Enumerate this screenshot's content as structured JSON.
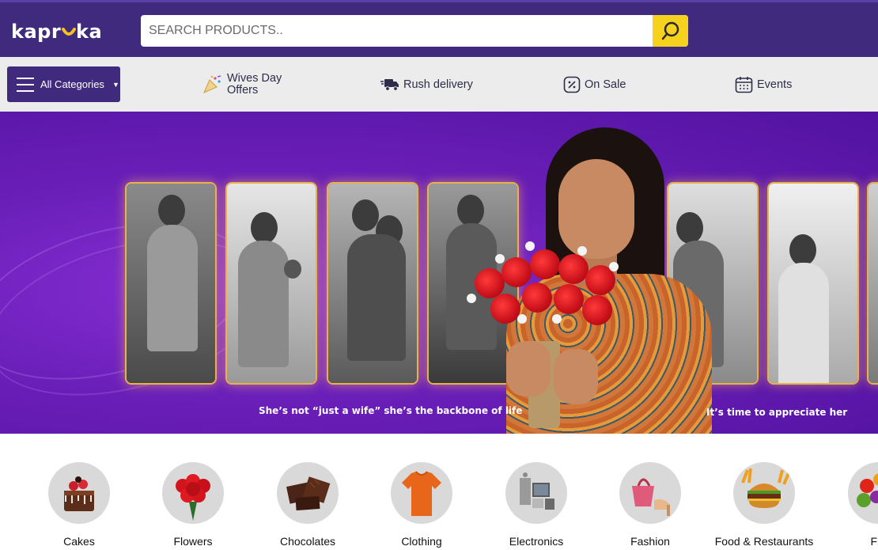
{
  "header": {
    "logo_text": "kapruka",
    "search": {
      "placeholder": "SEARCH PRODUCTS..",
      "value": ""
    },
    "colors": {
      "header_bg": "#3f2a7e",
      "search_button": "#f6d21e"
    }
  },
  "navbar": {
    "categories_button": "All Categories",
    "items": [
      {
        "label_line1": "Wives Day",
        "label_line2": "Offers",
        "icon": "party-popper-icon"
      },
      {
        "label": "Rush delivery",
        "icon": "delivery-truck-icon"
      },
      {
        "label": "On Sale",
        "icon": "percent-tag-icon"
      },
      {
        "label": "Events",
        "icon": "calendar-icon"
      }
    ]
  },
  "hero": {
    "caption_left": "She’s not “just a wife” she’s the backbone of life",
    "caption_right": "It’s time to appreciate her"
  },
  "categories": [
    {
      "label": "Cakes",
      "icon": "cake-icon"
    },
    {
      "label": "Flowers",
      "icon": "flowers-icon"
    },
    {
      "label": "Chocolates",
      "icon": "chocolate-icon"
    },
    {
      "label": "Clothing",
      "icon": "tshirt-icon"
    },
    {
      "label": "Electronics",
      "icon": "electronics-icon"
    },
    {
      "label": "Fashion",
      "icon": "handbag-icon"
    },
    {
      "label": "Food & Restaurants",
      "icon": "burger-icon"
    },
    {
      "label": "Fru",
      "icon": "fruits-icon"
    }
  ]
}
